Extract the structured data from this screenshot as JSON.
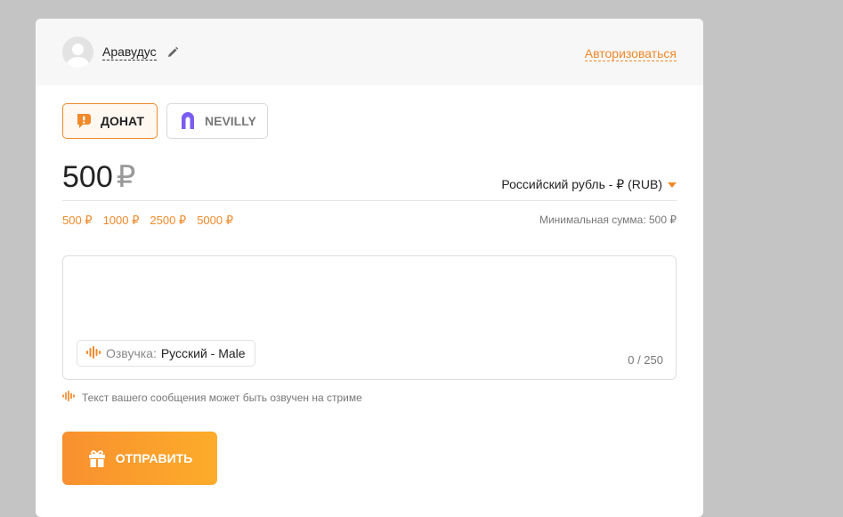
{
  "header": {
    "username": "Аравудус",
    "login_label": "Авторизоваться"
  },
  "tabs": [
    {
      "label": "ДОНАТ",
      "active": true
    },
    {
      "label": "NEVILLY",
      "active": false
    }
  ],
  "amount": {
    "value": "500",
    "currency_symbol": "₽"
  },
  "currency_select": {
    "selected": "Российский рубль - ₽ (RUB)"
  },
  "presets": [
    "500 ₽",
    "1000 ₽",
    "2500 ₽",
    "5000 ₽"
  ],
  "min_sum_label": "Минимальная сумма: 500 ₽",
  "message": {
    "voice_label": "Озвучка:",
    "voice_value": "Русский - Male",
    "counter": "0 / 250"
  },
  "hint_text": "Текст вашего сообщения может быть озвучен на стриме",
  "send_label": "ОТПРАВИТЬ",
  "colors": {
    "accent": "#f0892a",
    "nevilly": "#7b5cf0"
  }
}
